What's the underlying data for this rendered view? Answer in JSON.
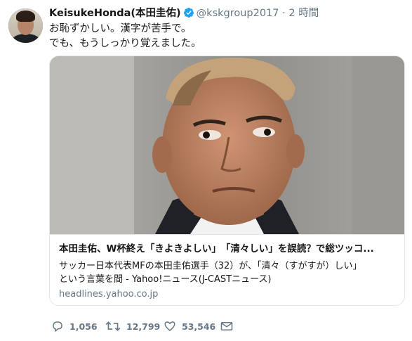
{
  "tweet": {
    "display_name": "KeisukeHonda(本田圭佑)",
    "handle": "@kskgroup2017",
    "separator": "·",
    "time": "2 時間",
    "text_lines": [
      "お恥ずかしい。漢字が苦手で。",
      "でも、もうしっかり覚えました。"
    ]
  },
  "card": {
    "title": "本田圭佑、W杯終え「きよきよしい」　「清々しい」を誤読？で総ツッコ...",
    "description_lines": [
      "サッカー日本代表MFの本田圭佑選手（32）が、「清々（すがすが）しい」",
      "という言葉を間 - Yahoo!ニュース(J-CASTニュース)"
    ],
    "domain": "headlines.yahoo.co.jp"
  },
  "actions": {
    "replies": "1,056",
    "retweets": "12,799",
    "likes": "53,546"
  },
  "icons": {
    "verified": "verified-badge-icon",
    "reply": "reply-icon",
    "retweet": "retweet-icon",
    "like": "heart-icon",
    "dm": "envelope-icon"
  },
  "colors": {
    "text": "#14171a",
    "secondary": "#657786",
    "verified": "#1da1f2",
    "border": "#e1e8ed"
  }
}
